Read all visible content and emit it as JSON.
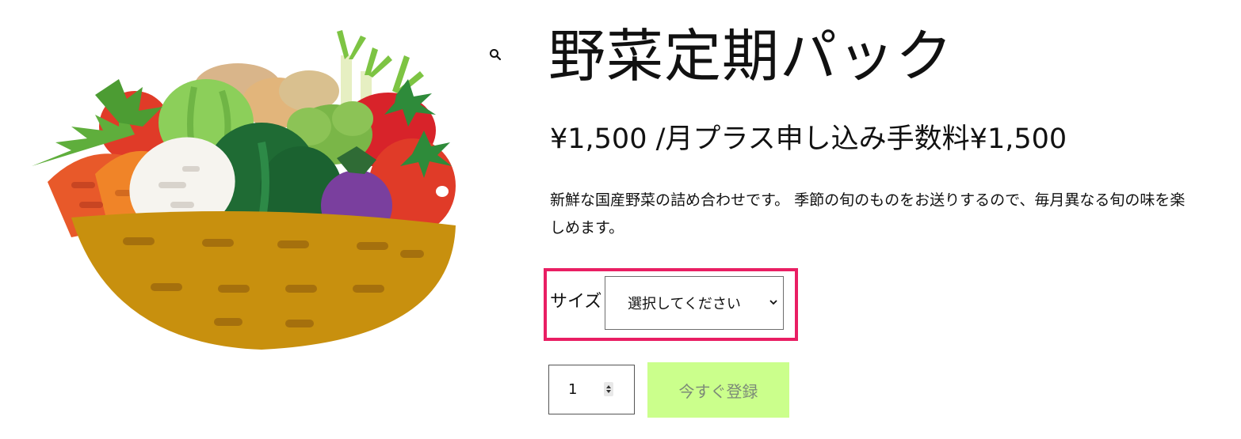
{
  "product": {
    "title": "野菜定期パック",
    "price": "¥1,500 /月プラス申し込み手数料¥1,500",
    "description": "新鮮な国産野菜の詰め合わせです。 季節の旬のものをお送りするので、毎月異なる旬の味を楽しめます。",
    "image_alt": "vegetable-basket-illustration"
  },
  "variation": {
    "label": "サイズ",
    "select_value": "選択してください"
  },
  "cart": {
    "quantity": "1",
    "add_button": "今すぐ登録",
    "add_button_color": "#cbff8c"
  },
  "icons": {
    "zoom": "search-icon",
    "select_arrow": "chevron-down-icon",
    "stepper": "spin-buttons-icon"
  },
  "colors": {
    "highlight": "#e91e63",
    "button_bg": "#cbff8c"
  }
}
